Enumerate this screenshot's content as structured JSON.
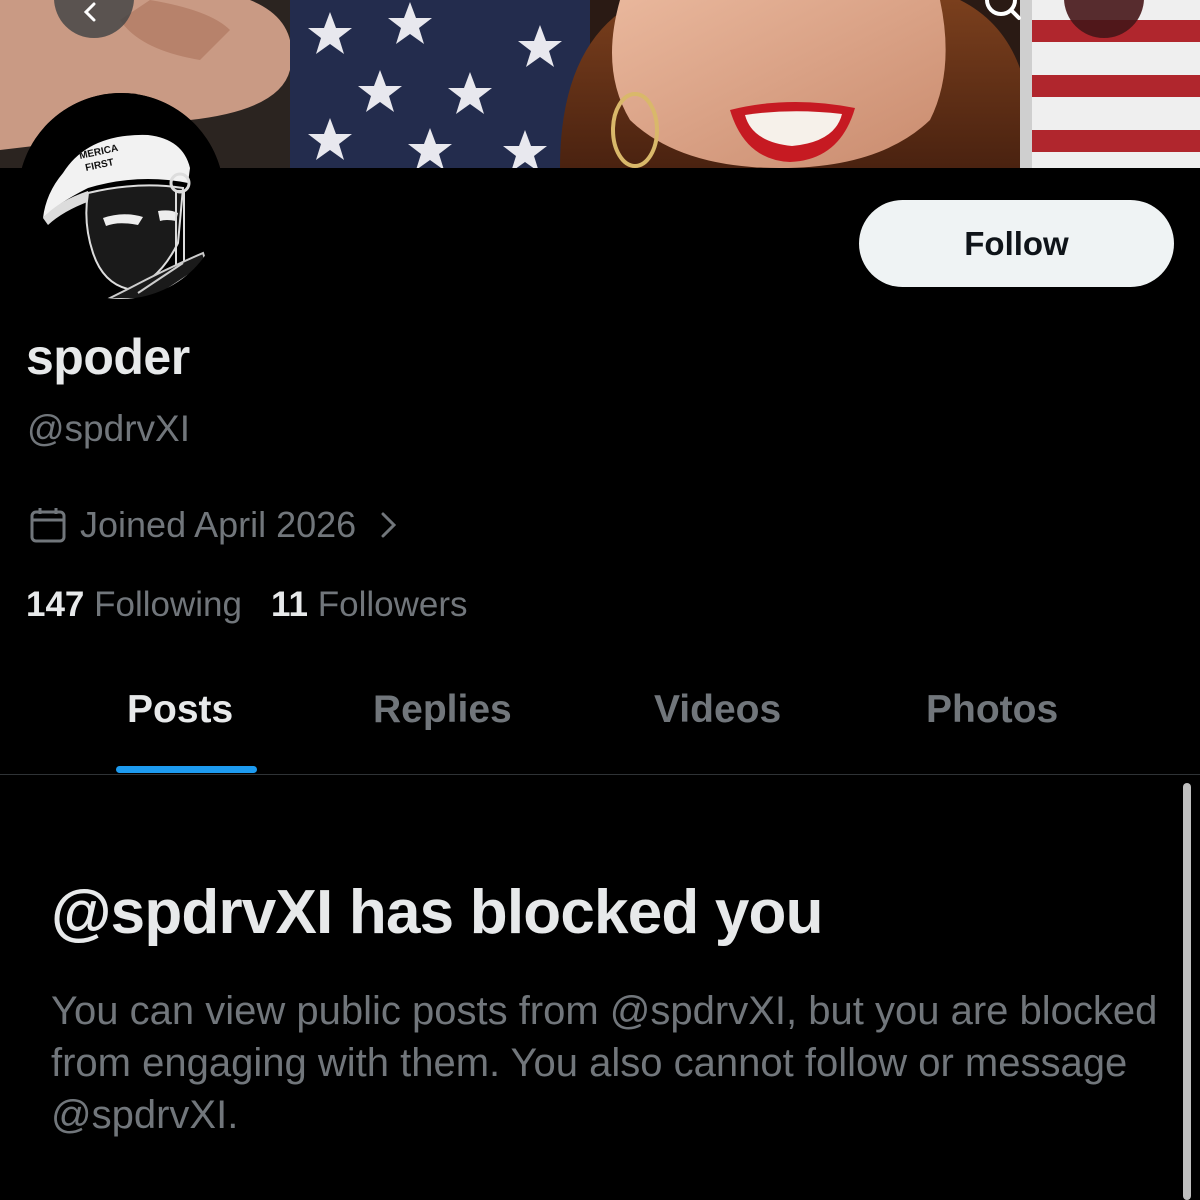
{
  "banner": {
    "description_icon": "banner-photo"
  },
  "header": {
    "back_icon": "back-arrow-icon",
    "search_icon": "search-icon",
    "more_icon": "more-icon"
  },
  "avatar": {
    "cap_text": "MERICA\nFIRST",
    "cap_line1": "MERICA",
    "cap_line2": "FIRST"
  },
  "profile": {
    "follow_label": "Follow",
    "display_name": "spoder",
    "handle": "@spdrvXI",
    "joined": "Joined April 2026",
    "following_count": "147",
    "following_label": "Following",
    "followers_count": "11",
    "followers_label": "Followers"
  },
  "tabs": [
    {
      "label": "Posts",
      "active": true
    },
    {
      "label": "Replies",
      "active": false
    },
    {
      "label": "Videos",
      "active": false
    },
    {
      "label": "Photos",
      "active": false
    }
  ],
  "blocked": {
    "title": "@spdrvXI has blocked you",
    "description": "You can view public posts from @spdrvXI, but you are blocked from engaging with them. You also cannot follow or message @spdrvXI."
  },
  "colors": {
    "background": "#000000",
    "text_primary": "#e7e9ea",
    "text_secondary": "#71767b",
    "accent": "#1d9bf0",
    "follow_bg": "#eff3f4"
  }
}
